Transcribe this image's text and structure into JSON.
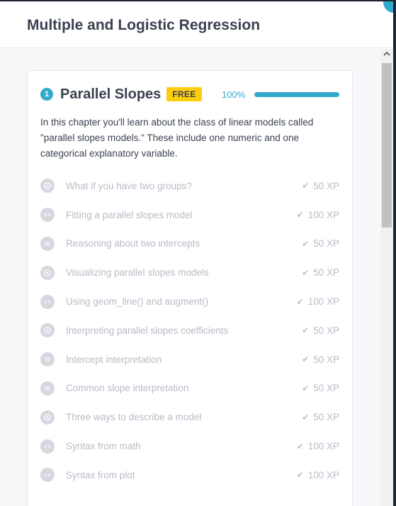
{
  "modal": {
    "title": "Multiple and Logistic Regression"
  },
  "chapter": {
    "number": "1",
    "title": "Parallel Slopes",
    "badge": "FREE",
    "progress_label": "100%",
    "progress": 1.0,
    "description": "In this chapter you'll learn about the class of linear models called \"parallel slopes models.\" These include one numeric and one categorical explanatory variable."
  },
  "exercises": [
    {
      "title": "What if you have two groups?",
      "xp": "50 XP",
      "icon": "video-icon"
    },
    {
      "title": "Fitting a parallel slopes model",
      "xp": "100 XP",
      "icon": "code-icon"
    },
    {
      "title": "Reasoning about two intercepts",
      "xp": "50 XP",
      "icon": "list-icon"
    },
    {
      "title": "Visualizing parallel slopes models",
      "xp": "50 XP",
      "icon": "video-icon"
    },
    {
      "title": "Using geom_line() and augment()",
      "xp": "100 XP",
      "icon": "code-icon"
    },
    {
      "title": "Interpreting parallel slopes coefficients",
      "xp": "50 XP",
      "icon": "video-icon"
    },
    {
      "title": "Intercept interpretation",
      "xp": "50 XP",
      "icon": "list-icon"
    },
    {
      "title": "Common slope interpretation",
      "xp": "50 XP",
      "icon": "list-icon"
    },
    {
      "title": "Three ways to describe a model",
      "xp": "50 XP",
      "icon": "video-icon"
    },
    {
      "title": "Syntax from math",
      "xp": "100 XP",
      "icon": "code-icon"
    },
    {
      "title": "Syntax from plot",
      "xp": "100 XP",
      "icon": "code-icon"
    }
  ],
  "colors": {
    "accent": "#33aacc",
    "badge": "#fcce0d",
    "title_text": "#3a4150",
    "muted_text": "#b7bcc6"
  }
}
